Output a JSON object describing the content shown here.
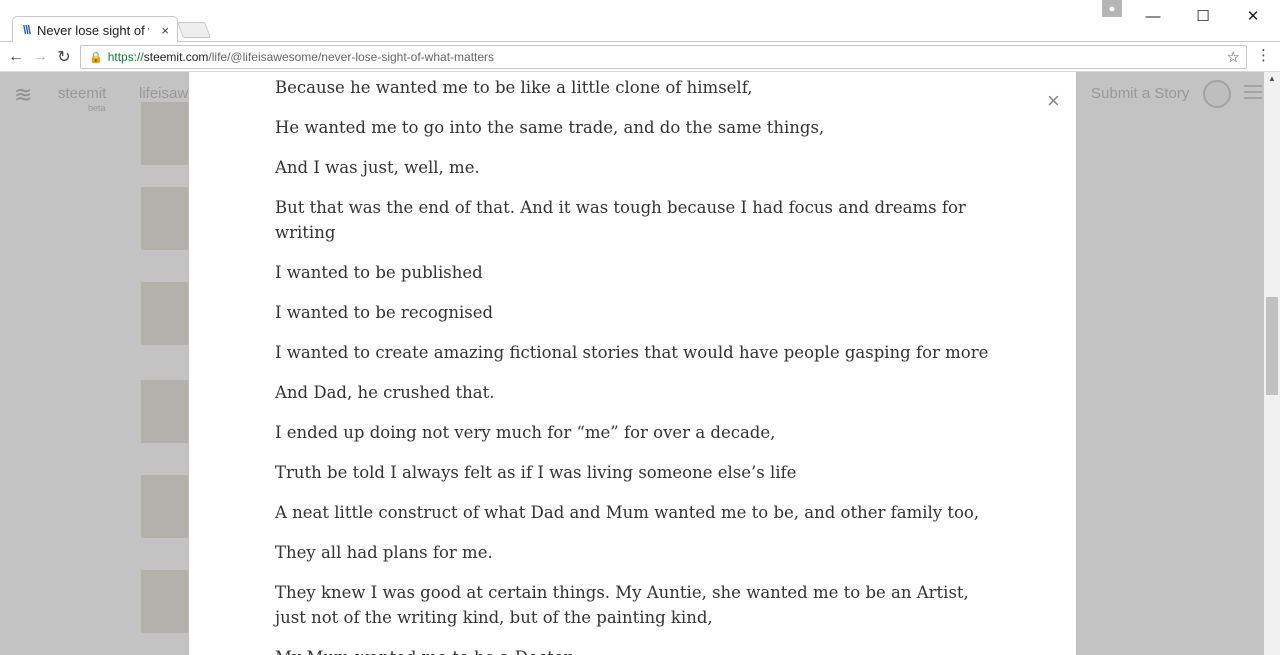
{
  "browser": {
    "tab": {
      "favicon": "steemit-icon",
      "title": "Never lose sight of what matters",
      "close": "×"
    },
    "window_controls": {
      "minimize": "—",
      "maximize": "☐",
      "close": "✕"
    },
    "nav": {
      "back": "←",
      "forward": "→",
      "reload": "↻"
    },
    "url": {
      "scheme": "https://",
      "host": "steemit.com",
      "path": "/life/@lifeisawesome/never-lose-sight-of-what-matters"
    },
    "bookmark_icon": "☆",
    "menu_icon": "⋮"
  },
  "site": {
    "logo": "steemit-logo",
    "name": "steemit",
    "beta": "beta",
    "section": "lifeisaw",
    "submit_story": "Submit a Story"
  },
  "modal": {
    "close_label": "×",
    "paragraphs": [
      "Because he wanted me to be like a little clone of himself,",
      "He wanted me to go into the same trade, and do the same things,",
      "And I was just, well, me.",
      "But that was the end of that. And it was tough because I had focus and dreams for writing",
      "I wanted to be published",
      "I wanted to be recognised",
      "I wanted to create amazing fictional stories that would have people gasping for more",
      "And Dad, he crushed that.",
      "I ended up doing not very much for “me” for over a decade,",
      "Truth be told I always felt as if I was living someone else’s life",
      "A neat little construct of what Dad and Mum wanted me to be, and other family too,",
      "They all had plans for me.",
      "They knew I was good at certain things. My Auntie, she wanted me to be an Artist, just not of the writing kind, but of the painting kind,",
      "My Mum wanted me to be a Doctor,"
    ]
  }
}
